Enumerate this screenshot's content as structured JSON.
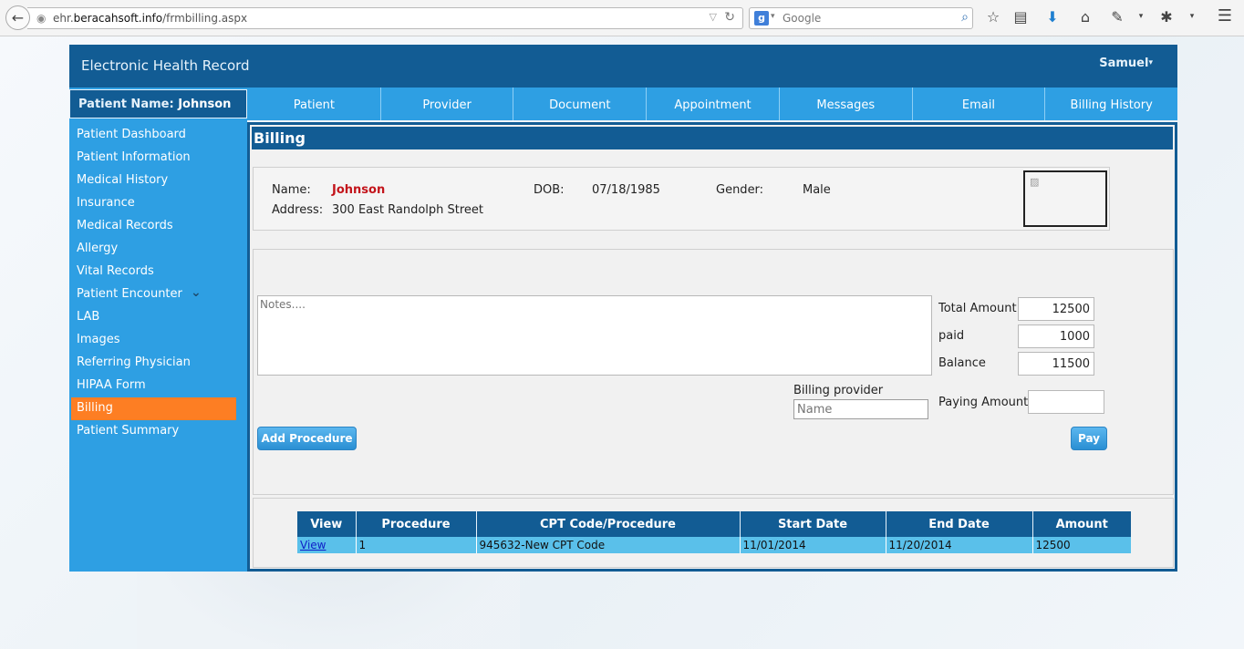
{
  "browser": {
    "url_prefix": "ehr.",
    "url_domain": "beracahsoft.info",
    "url_path": "/frmbilling.aspx",
    "search_placeholder": "Google"
  },
  "app": {
    "title": "Electronic Health Record",
    "user": "Samuel",
    "patient_label": "Patient Name:",
    "patient_name": "Johnson"
  },
  "tabs": [
    "Patient",
    "Provider",
    "Document",
    "Appointment",
    "Messages",
    "Email",
    "Billing History"
  ],
  "sidebar": {
    "items": [
      "Patient Dashboard",
      "Patient Information",
      "Medical History",
      "Insurance",
      "Medical Records",
      "Allergy",
      "Vital Records",
      "Patient Encounter",
      "LAB",
      "Images",
      "Referring Physician",
      "HIPAA Form",
      "Billing",
      "Patient Summary"
    ],
    "active": "Billing"
  },
  "page": {
    "title": "Billing"
  },
  "patient_info": {
    "name_label": "Name:",
    "name": "Johnson",
    "dob_label": "DOB:",
    "dob": "07/18/1985",
    "gender_label": "Gender:",
    "gender": "Male",
    "address_label": "Address:",
    "address": "300 East Randolph Street"
  },
  "billing_form": {
    "notes_placeholder": "Notes....",
    "total_label": "Total Amount",
    "total_value": "12500",
    "paid_label": "paid",
    "paid_value": "1000",
    "balance_label": "Balance",
    "balance_value": "11500",
    "provider_label": "Billing provider",
    "provider_placeholder": "Name",
    "paying_label": "Paying Amount",
    "paying_value": "",
    "add_procedure_label": "Add Procedure",
    "pay_label": "Pay"
  },
  "procedures": {
    "headers": [
      "View",
      "Procedure",
      "CPT Code/Procedure",
      "Start Date",
      "End Date",
      "Amount"
    ],
    "rows": [
      {
        "view": "View",
        "procedure": "1",
        "cpt": "945632-New CPT Code",
        "start": "11/01/2014",
        "end": "11/20/2014",
        "amount": "12500"
      }
    ]
  }
}
